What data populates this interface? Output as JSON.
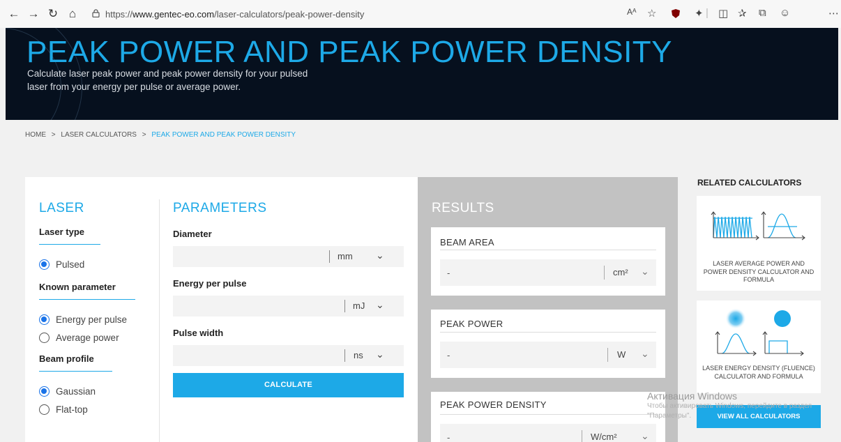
{
  "browser": {
    "url_prefix": "https://",
    "url_host": "www.gentec-eo.com",
    "url_path": "/laser-calculators/peak-power-density",
    "read_aloud_label": "Aᴬ"
  },
  "hero": {
    "title": "PEAK POWER AND PEAK POWER DENSITY",
    "subtitle": "Calculate laser peak power and peak power density for your pulsed laser from your energy per pulse or average power."
  },
  "breadcrumb": {
    "home": "HOME",
    "sep": ">",
    "calculators": "LASER CALCULATORS",
    "current": "PEAK POWER AND PEAK POWER DENSITY"
  },
  "laser": {
    "title": "LASER",
    "laser_type_label": "Laser type",
    "laser_type_options": [
      "Pulsed"
    ],
    "known_parameter_label": "Known parameter",
    "known_parameter_options": [
      "Energy per pulse",
      "Average power"
    ],
    "beam_profile_label": "Beam profile",
    "beam_profile_options": [
      "Gaussian",
      "Flat-top"
    ]
  },
  "parameters": {
    "title": "PARAMETERS",
    "diameter_label": "Diameter",
    "diameter_unit": "mm",
    "energy_label": "Energy per pulse",
    "energy_unit": "mJ",
    "pulse_label": "Pulse width",
    "pulse_unit": "ns",
    "calculate_label": "CALCULATE"
  },
  "results": {
    "title": "RESULTS",
    "beam_area_label": "BEAM AREA",
    "beam_area_value": "-",
    "beam_area_unit": "cm²",
    "peak_power_label": "PEAK POWER",
    "peak_power_value": "-",
    "peak_power_unit": "W",
    "density_label": "PEAK POWER DENSITY",
    "density_value": "-",
    "density_unit": "W/cm²"
  },
  "related": {
    "title": "RELATED CALCULATORS",
    "card1_caption": "LASER AVERAGE POWER AND POWER DENSITY CALCULATOR AND FORMULA",
    "card2_caption": "LASER ENERGY DENSITY (FLUENCE) CALCULATOR AND FORMULA",
    "view_all_label": "VIEW ALL CALCULATORS"
  },
  "watermark": {
    "title": "Активация Windows",
    "line1": "Чтобы активировать Windows, перейдите в раздел",
    "line2": "\"Параметры\"."
  },
  "colors": {
    "accent": "#1da9e7",
    "hero_bg": "#06101e",
    "radio": "#1a73e8",
    "results_bg": "#c2c2c2"
  },
  "icons": [
    "back-arrow-icon",
    "forward-arrow-icon",
    "refresh-icon",
    "home-icon",
    "lock-icon",
    "favorite-star-icon",
    "ublock-icon",
    "extensions-icon",
    "split-screen-icon",
    "favorites-icon",
    "collections-icon",
    "feedback-icon",
    "more-icon",
    "chevron-down-icon"
  ]
}
